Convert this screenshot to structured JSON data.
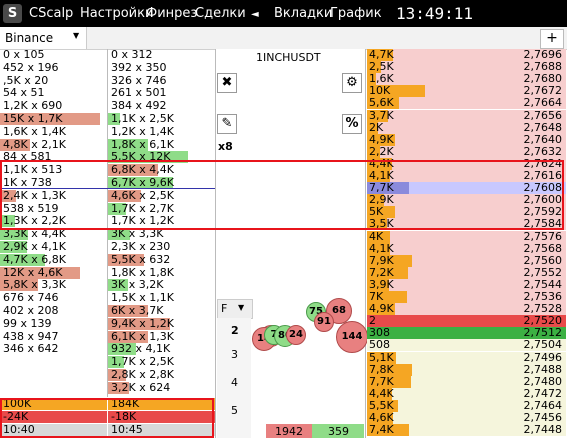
{
  "titlebar": {
    "logo": "S",
    "app_name": "CScalp",
    "menu": [
      "Настройки",
      "Финрез",
      "Сделки"
    ],
    "back_arrow": "◄",
    "menu_right": [
      "Вкладки",
      "График"
    ],
    "clock": "13:49:11"
  },
  "tabs": {
    "exchange": "Binance",
    "dropdown_arrow": "▼",
    "add": "+"
  },
  "ticker": "1INCHUSDT",
  "tools": {
    "close": "✖",
    "settings": "⚙",
    "chart": "✎",
    "percent": "%",
    "multiplier": "x8"
  },
  "cluster_timeframe": "F",
  "cluster_rows": [
    "2",
    "3",
    "4",
    "5"
  ],
  "trades": {
    "sell_volume": "1942",
    "buy_volume": "359"
  },
  "col1_rows": [
    {
      "t": "0 x 105",
      "c": "",
      "w": 0
    },
    {
      "t": "452 x 196",
      "c": "",
      "w": 0
    },
    {
      "t": ",5K x 20",
      "c": "",
      "w": 0
    },
    {
      "t": "54 x 51",
      "c": "",
      "w": 0
    },
    {
      "t": "1,2K x 690",
      "c": "",
      "w": 0
    },
    {
      "t": "15K x 1,7K",
      "c": "#e29a86",
      "w": 100
    },
    {
      "t": "1,6K x 1,4K",
      "c": "",
      "w": 0
    },
    {
      "t": "4,8K x 2,1K",
      "c": "#e29a86",
      "w": 30
    },
    {
      "t": "84 x 581",
      "c": "",
      "w": 0
    },
    {
      "t": "1,1K x 513",
      "c": "",
      "w": 0
    },
    {
      "t": "1K x 738",
      "c": "",
      "w": 0
    },
    {
      "t": "2,4K x 1,3K",
      "c": "#e29a86",
      "w": 16
    },
    {
      "t": "538 x 519",
      "c": "",
      "w": 0
    },
    {
      "t": "1,3K x 2,2K",
      "c": "#8fdc88",
      "w": 15
    },
    {
      "t": "3,3K x 4,4K",
      "c": "#8fdc88",
      "w": 28
    },
    {
      "t": "2,9K x 4,1K",
      "c": "#8fdc88",
      "w": 27
    },
    {
      "t": "4,7K x 6,8K",
      "c": "#8fdc88",
      "w": 45
    },
    {
      "t": "12K x 4,6K",
      "c": "#e29a86",
      "w": 80
    },
    {
      "t": "5,8K x 3,3K",
      "c": "#e29a86",
      "w": 38
    },
    {
      "t": "676 x 746",
      "c": "",
      "w": 0
    },
    {
      "t": "402 x 208",
      "c": "",
      "w": 0
    },
    {
      "t": "99 x 139",
      "c": "",
      "w": 0
    },
    {
      "t": "438 x 947",
      "c": "",
      "w": 0
    },
    {
      "t": "346 x 642",
      "c": "",
      "w": 0
    }
  ],
  "col2_rows": [
    {
      "t": "0 x 312",
      "c": "",
      "w": 0
    },
    {
      "t": "392 x 350",
      "c": "",
      "w": 0
    },
    {
      "t": "326 x 746",
      "c": "",
      "w": 0
    },
    {
      "t": "261 x 501",
      "c": "",
      "w": 0
    },
    {
      "t": "384 x 492",
      "c": "",
      "w": 0
    },
    {
      "t": "1,1K x 2,5K",
      "c": "#8fdc88",
      "w": 12
    },
    {
      "t": "1,2K x 1,4K",
      "c": "",
      "w": 0
    },
    {
      "t": "1,8K x 6,1K",
      "c": "#8fdc88",
      "w": 40
    },
    {
      "t": "5,5K x 12K",
      "c": "#8fdc88",
      "w": 80
    },
    {
      "t": "6,8K x 4,4K",
      "c": "#e29a86",
      "w": 50
    },
    {
      "t": "6,7K x 9,6K",
      "c": "#8fdc88",
      "w": 65
    },
    {
      "t": "4,6K x 2,5K",
      "c": "#e29a86",
      "w": 33
    },
    {
      "t": "1,7K x 2,7K",
      "c": "#8fdc88",
      "w": 18
    },
    {
      "t": "1,7K x 1,2K",
      "c": "",
      "w": 0
    },
    {
      "t": "3K x 3,3K",
      "c": "#8fdc88",
      "w": 22
    },
    {
      "t": "2,3K x 230",
      "c": "",
      "w": 0
    },
    {
      "t": "5,5K x 632",
      "c": "#e29a86",
      "w": 36
    },
    {
      "t": "1,8K x 1,8K",
      "c": "",
      "w": 0
    },
    {
      "t": "3K x 3,2K",
      "c": "#8fdc88",
      "w": 20
    },
    {
      "t": "1,5K x 1,1K",
      "c": "",
      "w": 0
    },
    {
      "t": "6K x 3,7K",
      "c": "#e29a86",
      "w": 40
    },
    {
      "t": "9,4K x 1,2K",
      "c": "#e29a86",
      "w": 62
    },
    {
      "t": "6,1K x 1,3K",
      "c": "#e29a86",
      "w": 40
    },
    {
      "t": "932 x 4,1K",
      "c": "#8fdc88",
      "w": 28
    },
    {
      "t": "1,7K x 2,5K",
      "c": "#8fdc88",
      "w": 16
    },
    {
      "t": "2,8K x 2,8K",
      "c": "#e29a86",
      "w": 18
    },
    {
      "t": "3,2K x 624",
      "c": "#e29a86",
      "w": 21
    }
  ],
  "ladder": [
    {
      "v": "4,7K",
      "p": "2,7696",
      "side": "ask",
      "w": 26
    },
    {
      "v": "2,5K",
      "p": "2,7688",
      "side": "ask",
      "w": 14
    },
    {
      "v": "1,6K",
      "p": "2,7680",
      "side": "ask",
      "w": 9
    },
    {
      "v": "10K",
      "p": "2,7672",
      "side": "ask",
      "w": 58
    },
    {
      "v": "5,6K",
      "p": "2,7664",
      "side": "ask",
      "w": 32
    },
    {
      "v": "3,7K",
      "p": "2,7656",
      "side": "ask",
      "w": 21
    },
    {
      "v": "2K",
      "p": "2,7648",
      "side": "ask",
      "w": 11
    },
    {
      "v": "4,9K",
      "p": "2,7640",
      "side": "ask",
      "w": 28
    },
    {
      "v": "2,2K",
      "p": "2,7632",
      "side": "ask",
      "w": 13
    },
    {
      "v": "4,4K",
      "p": "2,7624",
      "side": "ask",
      "w": 25
    },
    {
      "v": "4,1K",
      "p": "2,7616",
      "side": "ask",
      "w": 23
    },
    {
      "v": "7,7K",
      "p": "2,7608",
      "side": "mark",
      "w": 42
    },
    {
      "v": "2,9K",
      "p": "2,7600",
      "side": "ask",
      "w": 17
    },
    {
      "v": "5K",
      "p": "2,7592",
      "side": "ask",
      "w": 28
    },
    {
      "v": "3,5K",
      "p": "2,7584",
      "side": "ask",
      "w": 20
    },
    {
      "v": "4K",
      "p": "2,7576",
      "side": "ask",
      "w": 23
    },
    {
      "v": "4,1K",
      "p": "2,7568",
      "side": "ask",
      "w": 23
    },
    {
      "v": "7,9K",
      "p": "2,7560",
      "side": "ask",
      "w": 45
    },
    {
      "v": "7,2K",
      "p": "2,7552",
      "side": "ask",
      "w": 41
    },
    {
      "v": "3,9K",
      "p": "2,7544",
      "side": "ask",
      "w": 22
    },
    {
      "v": "7K",
      "p": "2,7536",
      "side": "ask",
      "w": 40
    },
    {
      "v": "4,9K",
      "p": "2,7528",
      "side": "ask",
      "w": 28
    },
    {
      "v": "2",
      "p": "2,7520",
      "side": "best_ask",
      "w": 0
    },
    {
      "v": "308",
      "p": "2,7512",
      "side": "best_bid",
      "w": 0
    },
    {
      "v": "508",
      "p": "2,7504",
      "side": "bid",
      "w": 0
    },
    {
      "v": "5,1K",
      "p": "2,7496",
      "side": "bid",
      "w": 29
    },
    {
      "v": "7,8K",
      "p": "2,7488",
      "side": "bid",
      "w": 45
    },
    {
      "v": "7,7K",
      "p": "2,7480",
      "side": "bid",
      "w": 44
    },
    {
      "v": "4,4K",
      "p": "2,7472",
      "side": "bid",
      "w": 25
    },
    {
      "v": "5,5K",
      "p": "2,7464",
      "side": "bid",
      "w": 31
    },
    {
      "v": "4,6K",
      "p": "2,7456",
      "side": "bid",
      "w": 26
    },
    {
      "v": "7,4K",
      "p": "2,7448",
      "side": "bid",
      "w": 42
    }
  ],
  "bubbles": [
    {
      "v": "75",
      "c": "g"
    },
    {
      "v": "68",
      "c": "r"
    },
    {
      "v": "91",
      "c": "r"
    },
    {
      "v": "5",
      "c": "r"
    },
    {
      "v": "14",
      "c": "r"
    },
    {
      "v": "7",
      "c": "g"
    },
    {
      "v": "80",
      "c": "g"
    },
    {
      "v": "24",
      "c": "r"
    },
    {
      "v": "144",
      "c": "r"
    }
  ],
  "footer": {
    "pnl1_left": "100K",
    "pnl1_right": "184K",
    "pnl2_left": "-24K",
    "pnl2_right": "-18K",
    "time_left": "10:40",
    "time_right": "10:45"
  }
}
